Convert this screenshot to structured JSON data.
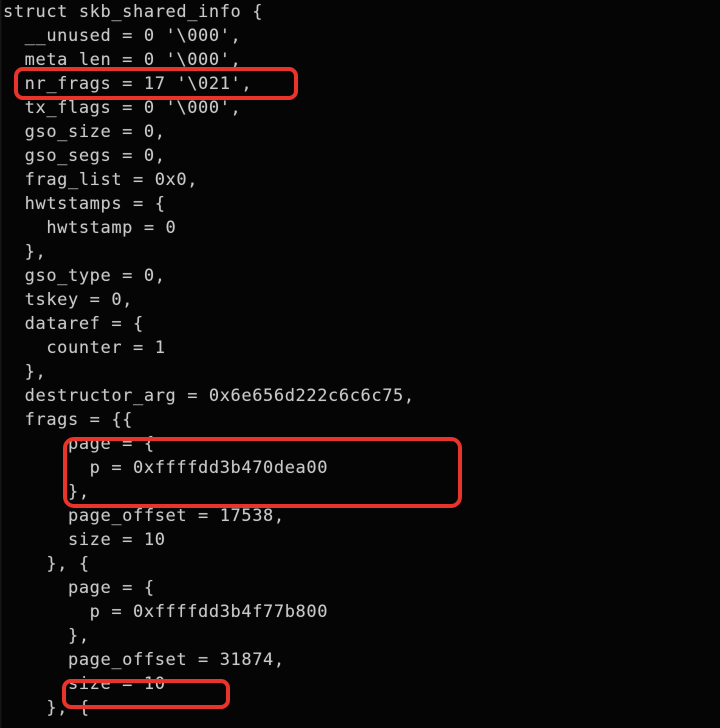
{
  "terminal": {
    "background_color": "#050505",
    "text_color": "#c9c9c9",
    "annotation_color": "#e8342a",
    "lines": [
      "struct skb_shared_info {",
      "  __unused = 0 '\\000',",
      "  meta_len = 0 '\\000',",
      "  nr_frags = 17 '\\021',",
      "  tx_flags = 0 '\\000',",
      "  gso_size = 0,",
      "  gso_segs = 0,",
      "  frag_list = 0x0,",
      "  hwtstamps = {",
      "    hwtstamp = 0",
      "  },",
      "  gso_type = 0,",
      "  tskey = 0,",
      "  dataref = {",
      "    counter = 1",
      "  },",
      "  destructor_arg = 0x6e656d222c6c6c75,",
      "  frags = {{",
      "      page = {",
      "        p = 0xffffdd3b470dea00",
      "      },",
      "      page_offset = 17538,",
      "      size = 10",
      "    }, {",
      "      page = {",
      "        p = 0xffffdd3b4f77b800",
      "      },",
      "      page_offset = 31874,",
      "      size = 10",
      "    }, {"
    ]
  },
  "annotations": [
    {
      "id": "nr-frags",
      "label": "nr_frags = 17 '\\021',",
      "shape": "rounded-rectangle"
    },
    {
      "id": "page-struct",
      "label": "page = { p = 0xffffdd3b470dea00 },",
      "shape": "rounded-rectangle"
    },
    {
      "id": "size",
      "label": "size = 10",
      "shape": "rounded-rectangle"
    }
  ]
}
